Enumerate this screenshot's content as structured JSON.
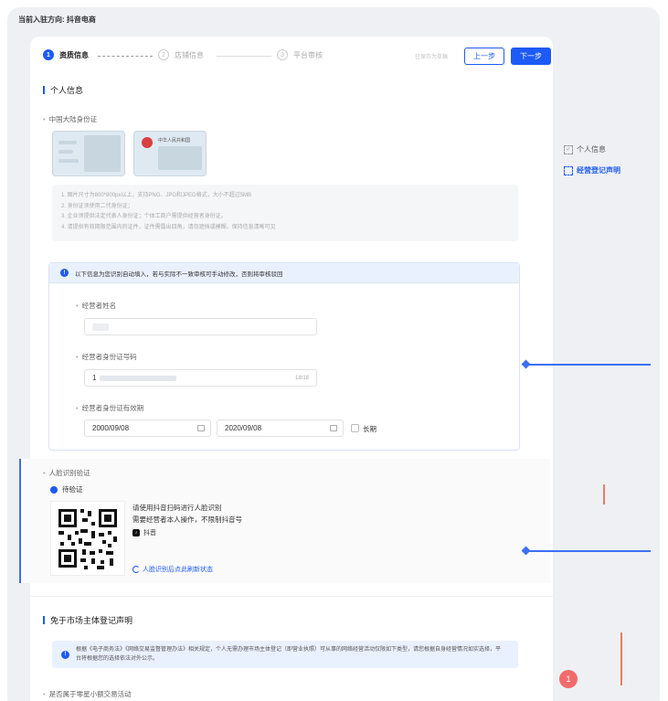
{
  "header": {
    "entry_direction": "当前入驻方向: 抖音电商"
  },
  "steps": [
    {
      "num": "1",
      "label": "资质信息"
    },
    {
      "num": "2",
      "label": "店铺信息"
    },
    {
      "num": "3",
      "label": "平台审核"
    }
  ],
  "toolbar": {
    "draft_status": "已保存为草稿",
    "prev_label": "上一步",
    "next_label": "下一步"
  },
  "personal": {
    "title": "个人信息",
    "id_label": "中国大陆身份证",
    "id_card_back_title": "中华人民共和国",
    "notes": [
      "1. 图片尺寸为800*800px以上，支持PNG、JPG和JPEG格式，大小不超过5MB",
      "2. 身份证须使用二代身份证；",
      "3. 企业须提供法定代表人身份证；个体工商户需提供经营者身份证。",
      "4. 请提供有效期限范围内的证件，证件需露出四角，请勿遮挡或模糊，保持信息清晰可见"
    ]
  },
  "auto_fill": {
    "banner": "以下信息为您识别自动填入，若与实际不一致审核可手动修改，否则将审核驳回",
    "name_label": "经营者姓名",
    "id_number_label": "经营者身份证号码",
    "id_number_prefix": "1",
    "id_number_counter": "18/18",
    "validity_label": "经营者身份证有效期",
    "start_date": "2000/09/08",
    "end_date": "2020/09/08",
    "long_term_label": "长期"
  },
  "face": {
    "title": "人脸识别验证",
    "status": "待验证",
    "instruction_1": "请使用抖音扫码进行人脸识别",
    "instruction_2": "需要经营者本人操作，不限制抖音号",
    "app_name": "抖音",
    "refresh_link": "人脸识别后点此刷新状态"
  },
  "exempt": {
    "title": "免于市场主体登记声明",
    "notice": "根据《电子商务法》《网络交易监督管理办法》相关规定，个人无需办理市场主体登记（即营业执照）可从事的网络经营活动仅限如下类型，请您根据自身经营情况如实选择，平台将根据您的选择依法对外公示。",
    "question": "是否属于零星小额交易活动"
  },
  "side_nav": [
    {
      "label": "个人信息"
    },
    {
      "label": "经营登记声明"
    }
  ],
  "badge": {
    "count": "1"
  },
  "colors": {
    "accent": "#1d5bf6",
    "annotation": "#3b6ff5",
    "alert": "#f26b6b"
  }
}
